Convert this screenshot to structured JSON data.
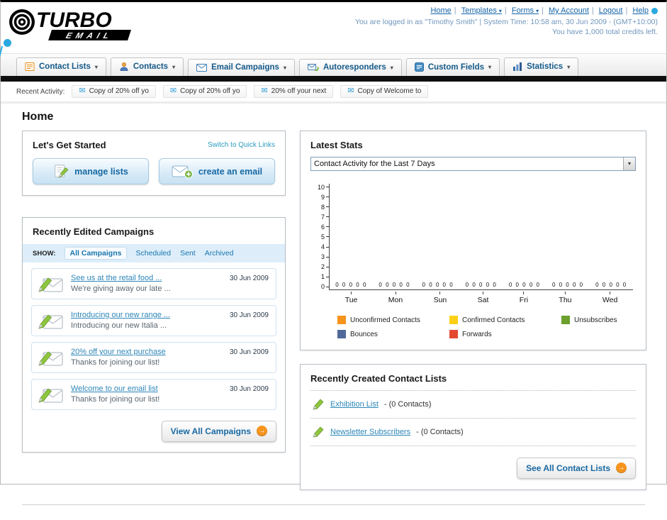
{
  "header": {
    "logo": {
      "title": "TURBO",
      "subtitle": "EMAIL"
    },
    "links": [
      "Home",
      "Templates",
      "Forms",
      "My Account",
      "Logout",
      "Help"
    ],
    "login_info": "You are logged in as \"Timothy Smith\" | System Time: 10:58 am, 30 Jun 2009 - (GMT+10:00)",
    "credits": "You have 1,000 total credits left."
  },
  "main_nav": {
    "items": [
      "Contact Lists",
      "Contacts",
      "Email Campaigns",
      "Autoresponders",
      "Custom Fields",
      "Statistics"
    ]
  },
  "recent_activity": {
    "label": "Recent Activity:",
    "items": [
      "Copy of 20% off yo",
      "Copy of 20% off yo",
      "20% off your next",
      "Copy of Welcome to"
    ]
  },
  "page_title": "Home",
  "get_started": {
    "title": "Let's Get Started",
    "switch_link": "Switch to Quick Links",
    "buttons": [
      "manage lists",
      "create an email"
    ]
  },
  "campaigns": {
    "title": "Recently Edited Campaigns",
    "show_label": "SHOW:",
    "tabs": [
      "All Campaigns",
      "Scheduled",
      "Sent",
      "Archived"
    ],
    "active_tab": "All Campaigns",
    "items": [
      {
        "title": "See us at the retail food ...",
        "subtitle": "We're giving away our late ...",
        "date": "30 Jun 2009"
      },
      {
        "title": "Introducing our new range ...",
        "subtitle": "Introducing our new Italia ...",
        "date": "30 Jun 2009"
      },
      {
        "title": "20% off your next purchase",
        "subtitle": "Thanks for joining our list!",
        "date": "30 Jun 2009"
      },
      {
        "title": "Welcome to our email list",
        "subtitle": "Thanks for joining our list!",
        "date": "30 Jun 2009"
      }
    ],
    "view_all_label": "View All Campaigns"
  },
  "stats": {
    "title": "Latest Stats",
    "select_value": "Contact Activity for the Last 7 Days",
    "chart_data": {
      "type": "bar",
      "title": "Contact Activity for the Last 7 Days",
      "categories": [
        "Tue",
        "Mon",
        "Sun",
        "Sat",
        "Fri",
        "Thu",
        "Wed"
      ],
      "series": [
        {
          "name": "Unconfirmed Contacts",
          "color": "#f7941d",
          "values": [
            0,
            0,
            0,
            0,
            0,
            0,
            0
          ]
        },
        {
          "name": "Confirmed Contacts",
          "color": "#fdd017",
          "values": [
            0,
            0,
            0,
            0,
            0,
            0,
            0
          ]
        },
        {
          "name": "Unsubscribes",
          "color": "#6ba12c",
          "values": [
            0,
            0,
            0,
            0,
            0,
            0,
            0
          ]
        },
        {
          "name": "Bounces",
          "color": "#50699b",
          "values": [
            0,
            0,
            0,
            0,
            0,
            0,
            0
          ]
        },
        {
          "name": "Forwards",
          "color": "#e2492f",
          "values": [
            0,
            0,
            0,
            0,
            0,
            0,
            0
          ]
        }
      ],
      "ylim": [
        0,
        10
      ],
      "yticks": [
        0,
        1,
        2,
        3,
        4,
        5,
        6,
        7,
        8,
        9,
        10
      ],
      "grid": false,
      "legend_position": "bottom"
    }
  },
  "contact_lists": {
    "title": "Recently Created Contact Lists",
    "items": [
      {
        "name": "Exhibition List",
        "detail": "- (0 Contacts)"
      },
      {
        "name": "Newsletter Subscribers",
        "detail": "- (0 Contacts)"
      }
    ],
    "see_all_label": "See All Contact Lists"
  },
  "colors": {
    "accent_orange": "#f7941d",
    "link_blue": "#1a75ad",
    "nav_black": "#0f0f0f",
    "swoosh_blue": "#2aa8e0"
  }
}
